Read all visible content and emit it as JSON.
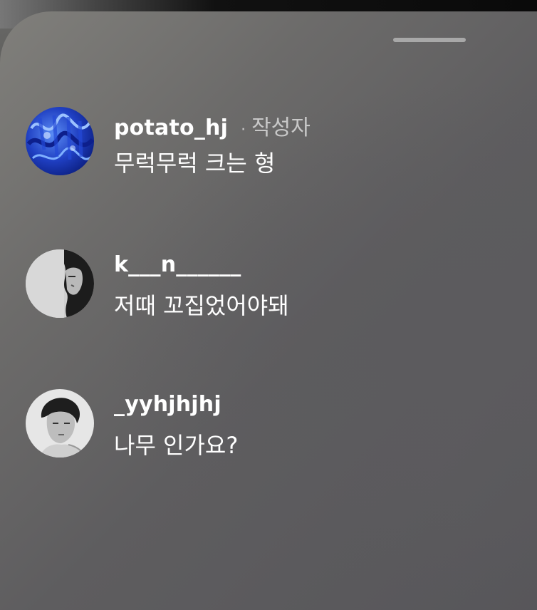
{
  "sheet": {
    "comments": [
      {
        "username": "potato_hj",
        "author_dot": "·",
        "author_badge": "작성자",
        "text": "무럭무럭 크는 형",
        "avatar": "blue-abstract-avatar"
      },
      {
        "username": "k___n______",
        "text": "저때 꼬집었어야돼",
        "avatar": "grayscale-half-face-avatar"
      },
      {
        "username": "_yyhjhjhj",
        "text": "나무 인가요?",
        "avatar": "grayscale-portrait-avatar"
      }
    ]
  },
  "colors": {
    "sheet": "#6c6b6a",
    "text": "#ffffff",
    "secondary_text": "#c8c8c8",
    "grabber": "#a8a8a8"
  }
}
